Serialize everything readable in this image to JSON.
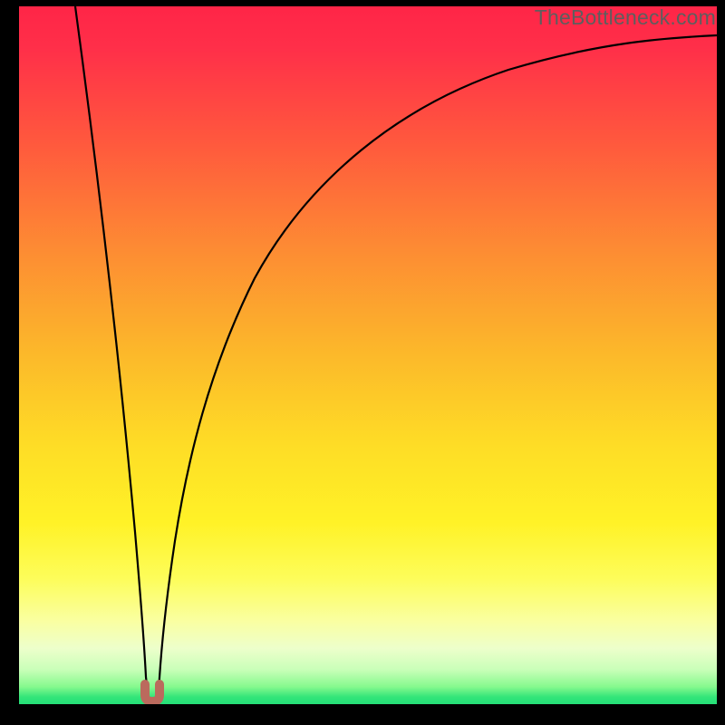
{
  "watermark": "TheBottleneck.com",
  "colors": {
    "background": "#000000",
    "gradient_top": "#ff2547",
    "gradient_bottom": "#25df78",
    "curve_stroke": "#000000",
    "marker_fill": "#bb6a5d"
  },
  "chart_data": {
    "type": "line",
    "title": "",
    "xlabel": "",
    "ylabel": "",
    "xlim": [
      0,
      100
    ],
    "ylim": [
      0,
      100
    ],
    "grid": false,
    "note": "Two curves over a vertical red→green gradient. Both descend to a common minimum near x≈18 (y≈0) then the right-hand curve rises logarithmically toward the top-right. Values are estimated from pixel position on an unlabeled 0–100 scale.",
    "series": [
      {
        "name": "left_curve",
        "x": [
          8,
          10,
          12,
          14,
          16,
          17,
          18
        ],
        "values": [
          100,
          80,
          60,
          40,
          20,
          6,
          1
        ]
      },
      {
        "name": "right_curve",
        "x": [
          20,
          22,
          24,
          28,
          32,
          38,
          45,
          55,
          65,
          75,
          85,
          100
        ],
        "values": [
          1,
          12,
          28,
          48,
          60,
          70,
          78,
          84,
          88,
          91,
          93,
          95
        ]
      }
    ],
    "marker": {
      "x": 18.5,
      "y": 0.8,
      "shape": "u"
    }
  }
}
